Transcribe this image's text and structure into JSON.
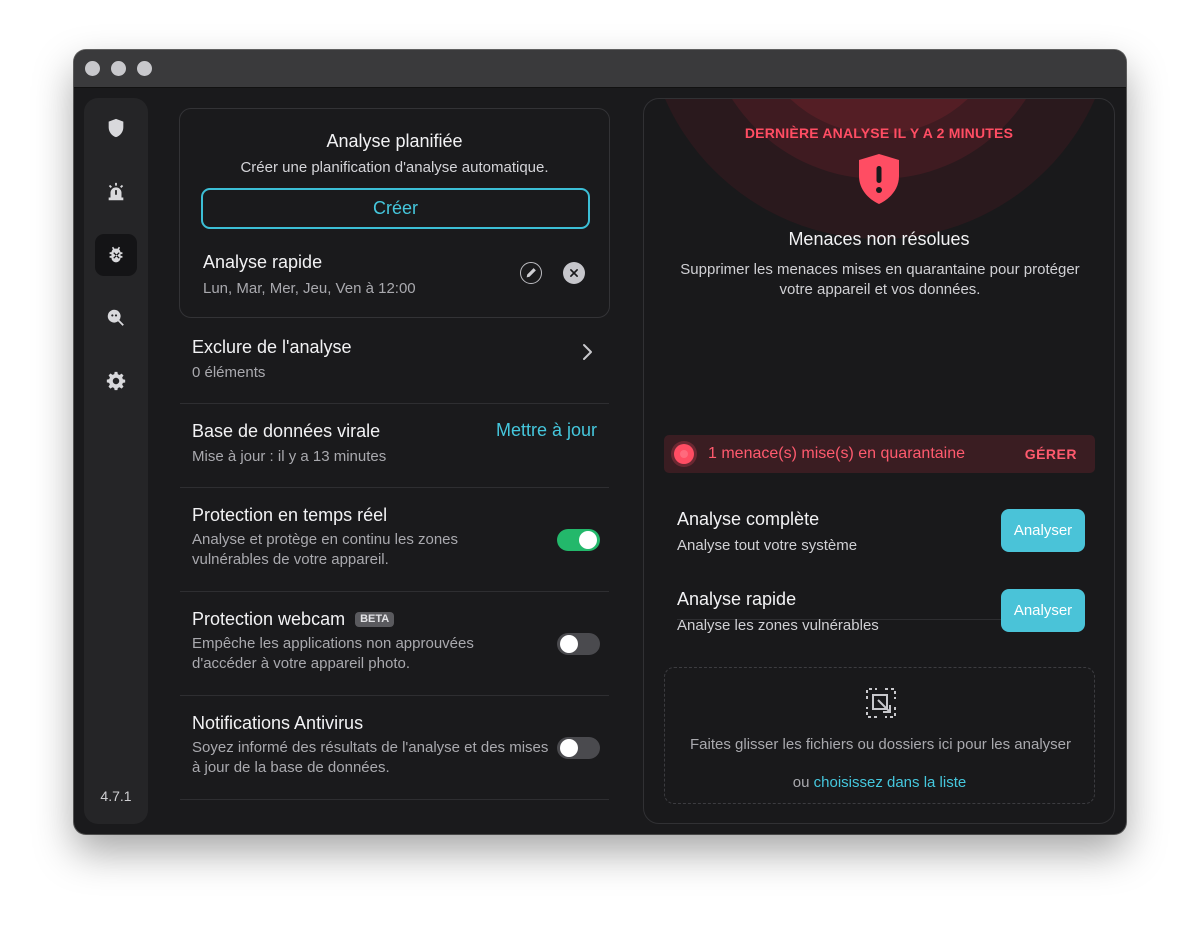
{
  "app": {
    "version": "4.7.1"
  },
  "sidebar": {
    "items": [
      {
        "icon": "shield-icon"
      },
      {
        "icon": "alarm-icon"
      },
      {
        "icon": "bug-icon",
        "active": true
      },
      {
        "icon": "search-bug-icon"
      },
      {
        "icon": "gear-icon"
      }
    ]
  },
  "scheduled": {
    "title": "Analyse planifiée",
    "subtitle": "Créer une planification d'analyse automatique.",
    "create_label": "Créer",
    "quick_scan_title": "Analyse rapide",
    "quick_scan_days": "Lun, Mar, Mer, Jeu, Ven à 12:00"
  },
  "settings": {
    "exclude": {
      "title": "Exclure de l'analyse",
      "subtitle": "0 éléments"
    },
    "database": {
      "title": "Base de données virale",
      "subtitle": "Mise à jour : il y a 13 minutes",
      "action": "Mettre à jour"
    },
    "realtime": {
      "title": "Protection en temps réel",
      "subtitle": "Analyse et protège en continu les zones vulnérables de votre appareil.",
      "enabled": true
    },
    "webcam": {
      "title": "Protection webcam",
      "badge": "BETA",
      "subtitle": "Empêche les applications non approuvées d'accéder à votre appareil photo.",
      "enabled": false
    },
    "notifications": {
      "title": "Notifications Antivirus",
      "subtitle": "Soyez informé des résultats de l'analyse et des mises à jour de la base de données.",
      "enabled": false
    }
  },
  "status": {
    "last_scan": "DERNIÈRE ANALYSE IL Y A 2 MINUTES",
    "threat_title": "Menaces non résolues",
    "threat_desc": "Supprimer les menaces mises en quarantaine pour protéger votre appareil et vos données.",
    "quarantine_text": "1 menace(s) mise(s) en quarantaine",
    "manage_label": "GÉRER",
    "accent": "#ff4d63"
  },
  "scans": [
    {
      "title": "Analyse complète",
      "subtitle": "Analyse tout votre système",
      "button": "Analyser"
    },
    {
      "title": "Analyse rapide",
      "subtitle": "Analyse les zones vulnérables",
      "button": "Analyser"
    }
  ],
  "dropzone": {
    "text": "Faites glisser les fichiers ou dossiers ici pour les analyser",
    "or": "ou",
    "link": "choisissez dans la liste"
  }
}
